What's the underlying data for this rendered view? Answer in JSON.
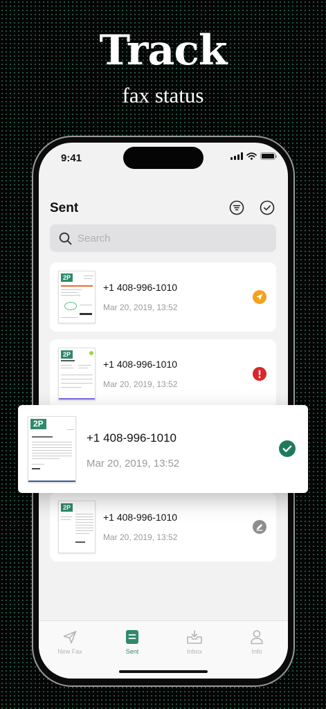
{
  "hero": {
    "title": "Track",
    "subtitle": "fax status"
  },
  "status_bar": {
    "time": "9:41"
  },
  "header": {
    "title": "Sent"
  },
  "search": {
    "placeholder": "Search",
    "value": ""
  },
  "thumbnail_logo": "2P",
  "faxes": [
    {
      "number": "+1 408-996-1010",
      "date": "Mar 20, 2019, 13:52",
      "status": "sending",
      "status_icon": "paper-plane-icon",
      "status_color": "#f3a21b"
    },
    {
      "number": "+1 408-996-1010",
      "date": "Mar 20, 2019, 13:52",
      "status": "failed",
      "status_icon": "exclamation-icon",
      "status_color": "#d9262b"
    },
    {
      "number": "+1 408-996-1010",
      "date": "Mar 20, 2019, 13:52",
      "status": "delivered",
      "status_icon": "checkmark-icon",
      "status_color": "#1f7a5c"
    },
    {
      "number": "+1 408-996-1010",
      "date": "Mar 20, 2019, 13:52",
      "status": "draft",
      "status_icon": "pencil-icon",
      "status_color": "#8e8e8e"
    }
  ],
  "tabs": [
    {
      "label": "New Fax",
      "icon": "paper-plane-icon",
      "active": false
    },
    {
      "label": "Sent",
      "icon": "document-icon",
      "active": true
    },
    {
      "label": "Inbox",
      "icon": "inbox-icon",
      "active": false
    },
    {
      "label": "Info",
      "icon": "person-icon",
      "active": false
    }
  ],
  "colors": {
    "accent": "#2f8a6a",
    "background": "#050505",
    "screen": "#f2f2f2"
  }
}
